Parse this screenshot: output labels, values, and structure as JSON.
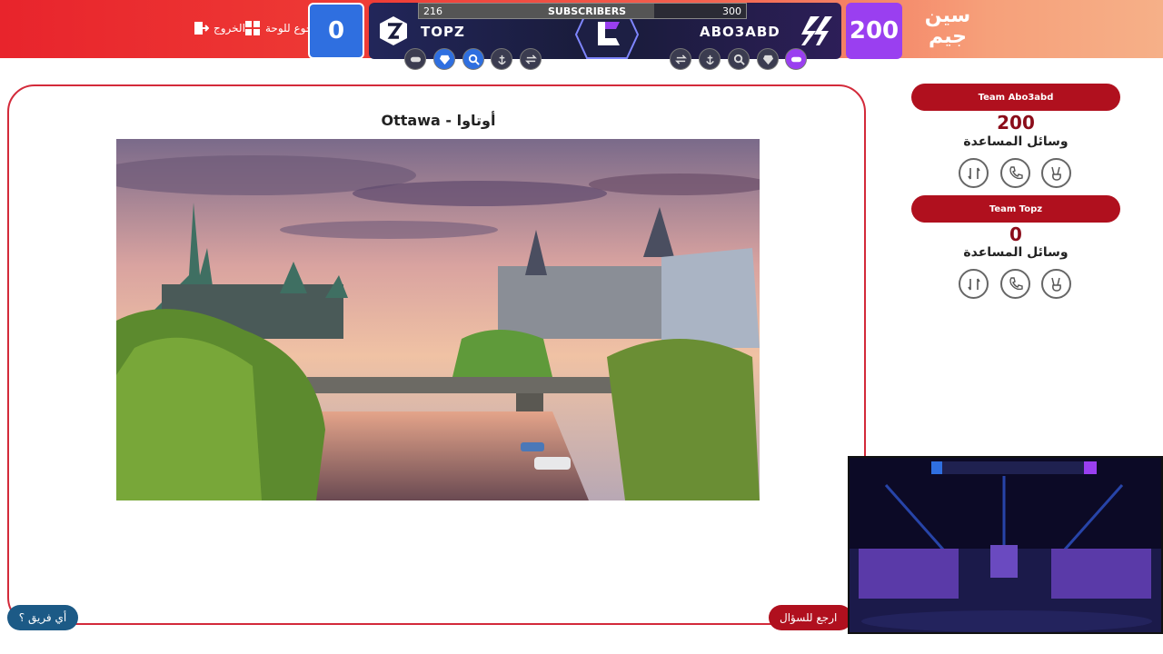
{
  "header": {
    "exit_label": "الخروج",
    "back_to_board_label": "رجوع للوحة",
    "brand_line1": "سين",
    "brand_line2": "جيم",
    "colors": {
      "red": "#e8242c",
      "blue_team": "#2f6fe0",
      "purple_team": "#9a3ff0"
    }
  },
  "scoreboard": {
    "left_team": {
      "name": "TOPZ",
      "score": "0"
    },
    "right_team": {
      "name": "ABO3ABD",
      "score": "200"
    },
    "subscribers": {
      "label": "SUBSCRIBERS",
      "current": "216",
      "goal": "300",
      "progress": 0.72
    },
    "left_powerups": [
      "gamepad-icon",
      "diamond-icon",
      "magnifier-icon",
      "anchor-icon",
      "swap-icon"
    ],
    "right_powerups": [
      "swap-icon",
      "anchor-icon",
      "magnifier-icon",
      "diamond-icon",
      "gamepad-icon"
    ]
  },
  "question": {
    "title": "Ottawa - أوتاوا",
    "image_alt": "Ottawa skyline"
  },
  "sidebar": {
    "teams": [
      {
        "name": "Team Abo3abd",
        "score": "200",
        "aids_label": "وسائل المساعدة"
      },
      {
        "name": "Team Topz",
        "score": "0",
        "aids_label": "وسائل المساعدة"
      }
    ]
  },
  "buttons": {
    "which_team": "أي فريق ؟",
    "back_to_question": "ارجع للسؤال"
  }
}
